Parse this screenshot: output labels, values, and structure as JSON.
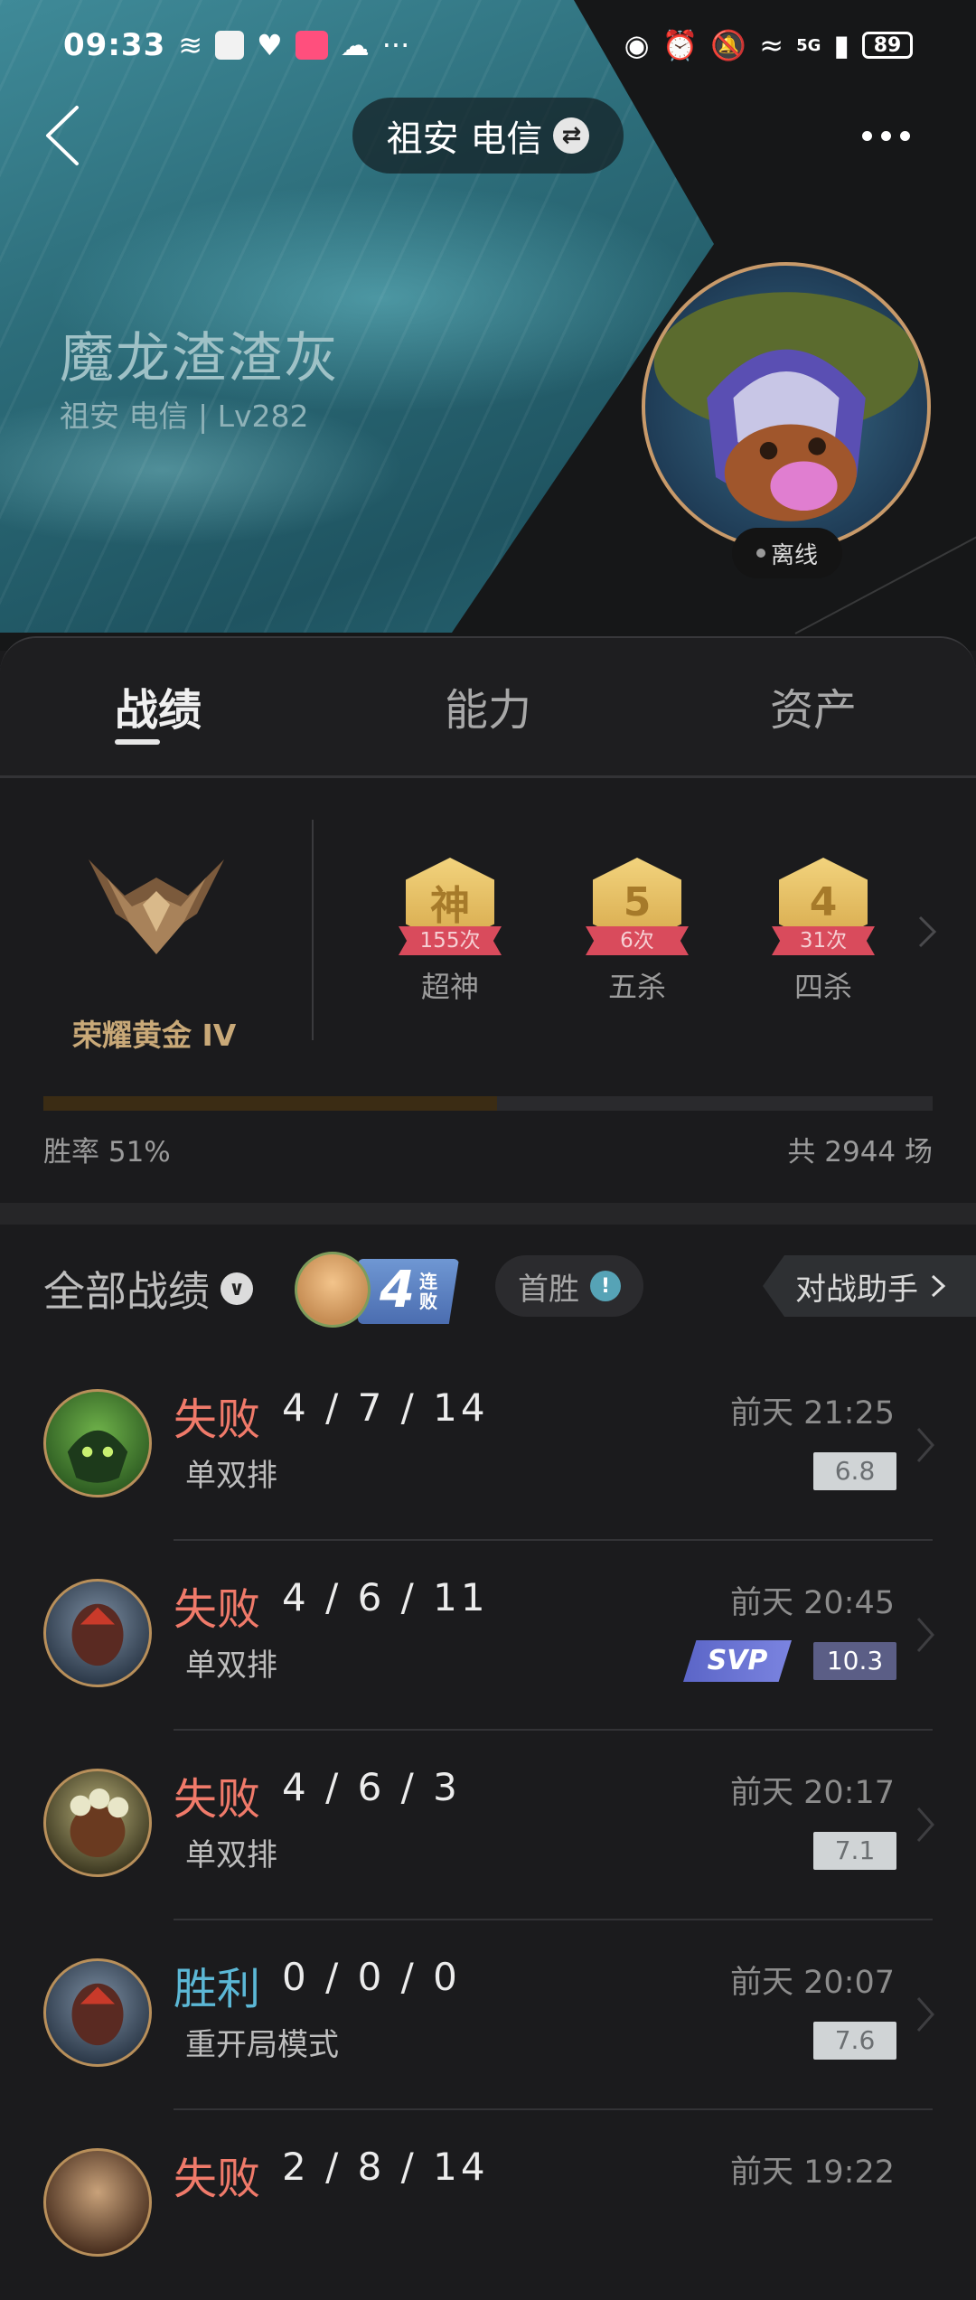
{
  "status_bar": {
    "time": "09:33",
    "battery": "89",
    "network": "5G"
  },
  "header": {
    "server_name": "祖安 电信",
    "back_icon": "chevron-left-icon",
    "more_icon": "more-dots-icon",
    "swap_icon": "swap-icon"
  },
  "profile": {
    "nickname": "魔龙渣渣灰",
    "subline": "祖安 电信 | Lv282",
    "status": "离线"
  },
  "tabs": [
    {
      "label": "战绩",
      "active": true
    },
    {
      "label": "能力",
      "active": false
    },
    {
      "label": "资产",
      "active": false
    }
  ],
  "rank": {
    "name": "荣耀黄金 IV",
    "badges": [
      {
        "symbol": "神",
        "count": "155次",
        "label": "超神"
      },
      {
        "symbol": "5",
        "count": "6次",
        "label": "五杀"
      },
      {
        "symbol": "4",
        "count": "31次",
        "label": "四杀"
      }
    ],
    "winrate_label": "胜率  51%",
    "winrate_value": 0.51,
    "total": "共 2944 场"
  },
  "filters": {
    "all_records": "全部战绩",
    "streak_number": "4",
    "streak_text": "连败",
    "first_win": "首胜",
    "first_win_info": "!",
    "assistant": "对战助手"
  },
  "matches": [
    {
      "result": "失败",
      "kda": "4 / 7 / 14",
      "mode": "单双排",
      "time": "前天 21:25",
      "score": "6.8",
      "svp": false
    },
    {
      "result": "失败",
      "kda": "4 / 6 / 11",
      "mode": "单双排",
      "time": "前天 20:45",
      "score": "10.3",
      "svp": true,
      "svp_label": "SVP"
    },
    {
      "result": "失败",
      "kda": "4 / 6 / 3",
      "mode": "单双排",
      "time": "前天 20:17",
      "score": "7.1",
      "svp": false
    },
    {
      "result": "胜利",
      "kda": "0 / 0 / 0",
      "mode": "重开局模式",
      "time": "前天 20:07",
      "score": "7.6",
      "svp": false
    },
    {
      "result": "失败",
      "kda": "2 / 8 / 14",
      "mode": "",
      "time": "前天 19:22",
      "score": "",
      "svp": false
    }
  ],
  "colors": {
    "lose": "#f07a6a",
    "win": "#5cb8d6",
    "gold": "#c9a978",
    "background": "#1b1b1d"
  }
}
